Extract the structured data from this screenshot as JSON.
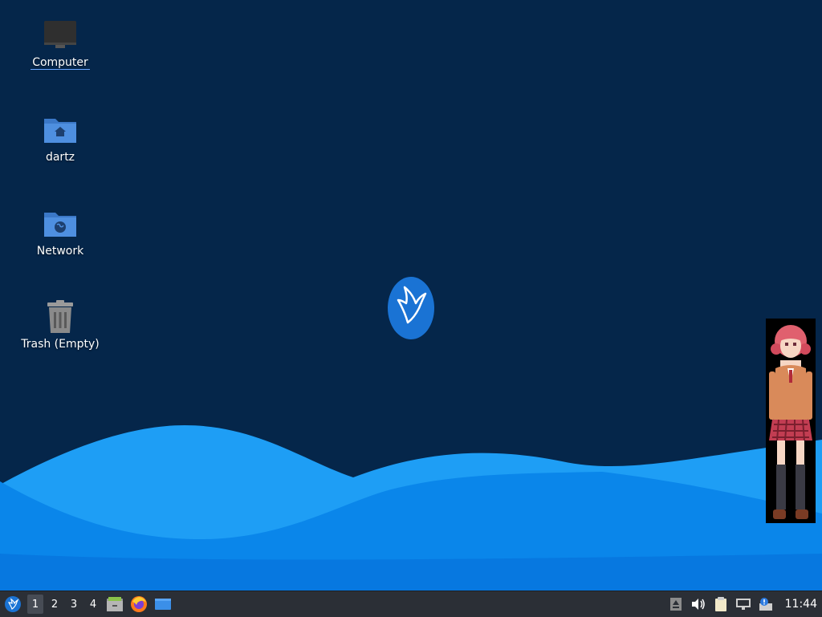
{
  "desktop": {
    "icons": [
      {
        "label": "Computer",
        "icon": "computer-icon"
      },
      {
        "label": "dartz",
        "icon": "home-folder-icon"
      },
      {
        "label": "Network",
        "icon": "network-folder-icon"
      },
      {
        "label": "Trash (Empty)",
        "icon": "trash-icon"
      }
    ]
  },
  "taskbar": {
    "workspaces": [
      "1",
      "2",
      "3",
      "4"
    ],
    "active_workspace": "1",
    "launchers": [
      "file-manager-icon",
      "firefox-icon",
      "desktop-icon"
    ],
    "tray": [
      "removable-drive-icon",
      "volume-icon",
      "clipboard-icon",
      "network-icon",
      "update-notifier-icon"
    ],
    "clock": "11:44"
  },
  "colors": {
    "background": "#05264a",
    "wave_light": "#1a9cf0",
    "wave_dark": "#0a6fe0",
    "panel": "#2b2f36"
  }
}
